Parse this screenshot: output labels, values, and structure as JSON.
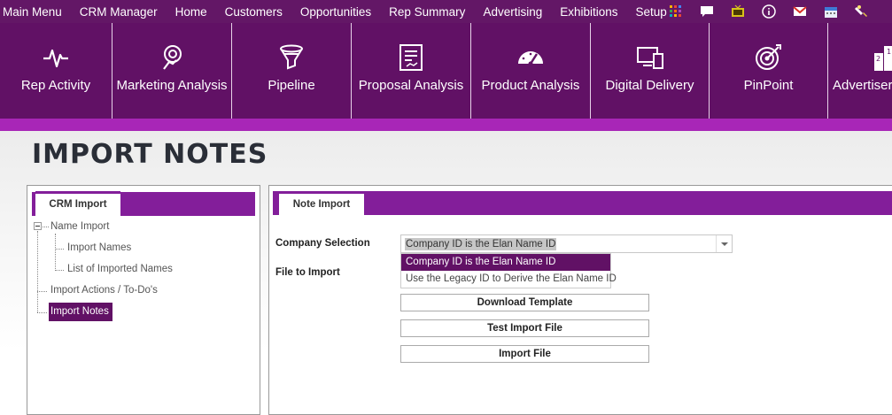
{
  "top_menu": [
    "Main Menu",
    "CRM Manager",
    "Home",
    "Customers",
    "Opportunities",
    "Rep Summary",
    "Advertising",
    "Exhibitions",
    "Setup"
  ],
  "top_icons": [
    "apps-grid-icon",
    "chat-icon",
    "tv-icon",
    "info-icon",
    "mail-icon",
    "calendar-icon",
    "paint-brush-icon"
  ],
  "tiles": [
    {
      "label": "Rep Activity",
      "icon": "pulse-icon"
    },
    {
      "label": "Marketing Analysis",
      "icon": "target-hand-icon"
    },
    {
      "label": "Pipeline",
      "icon": "funnel-icon"
    },
    {
      "label": "Proposal Analysis",
      "icon": "document-pen-icon"
    },
    {
      "label": "Product Analysis",
      "icon": "gauge-icon"
    },
    {
      "label": "Digital Delivery",
      "icon": "devices-icon"
    },
    {
      "label": "PinPoint",
      "icon": "dartboard-icon"
    },
    {
      "label": "Advertiser",
      "icon": "podium-icon"
    }
  ],
  "page_title": "IMPORT NOTES",
  "left_panel": {
    "tab_label": "CRM Import",
    "tree": {
      "root": "Name Import",
      "children": [
        "Import Names",
        "List of Imported Names"
      ],
      "siblings": [
        "Import Actions / To-Do's",
        "Import Notes"
      ],
      "selected": "Import Notes"
    }
  },
  "right_panel": {
    "tab_label": "Note Import",
    "company_selection_label": "Company Selection",
    "company_selection_value": "Company ID is the Elan Name ID",
    "file_to_import_label": "File to Import",
    "dropdown_options": [
      "Company ID is the Elan Name ID",
      "Use the Legacy ID to Derive the Elan Name ID"
    ],
    "buttons": {
      "download_template": "Download Template",
      "test_import_file": "Test Import File",
      "import_file": "Import File"
    }
  },
  "colors": {
    "topbar": "#631766",
    "tilebar": "#611165",
    "accent_strip": "#a826b7",
    "tab_strip": "#831e9a",
    "selected": "#611165"
  }
}
